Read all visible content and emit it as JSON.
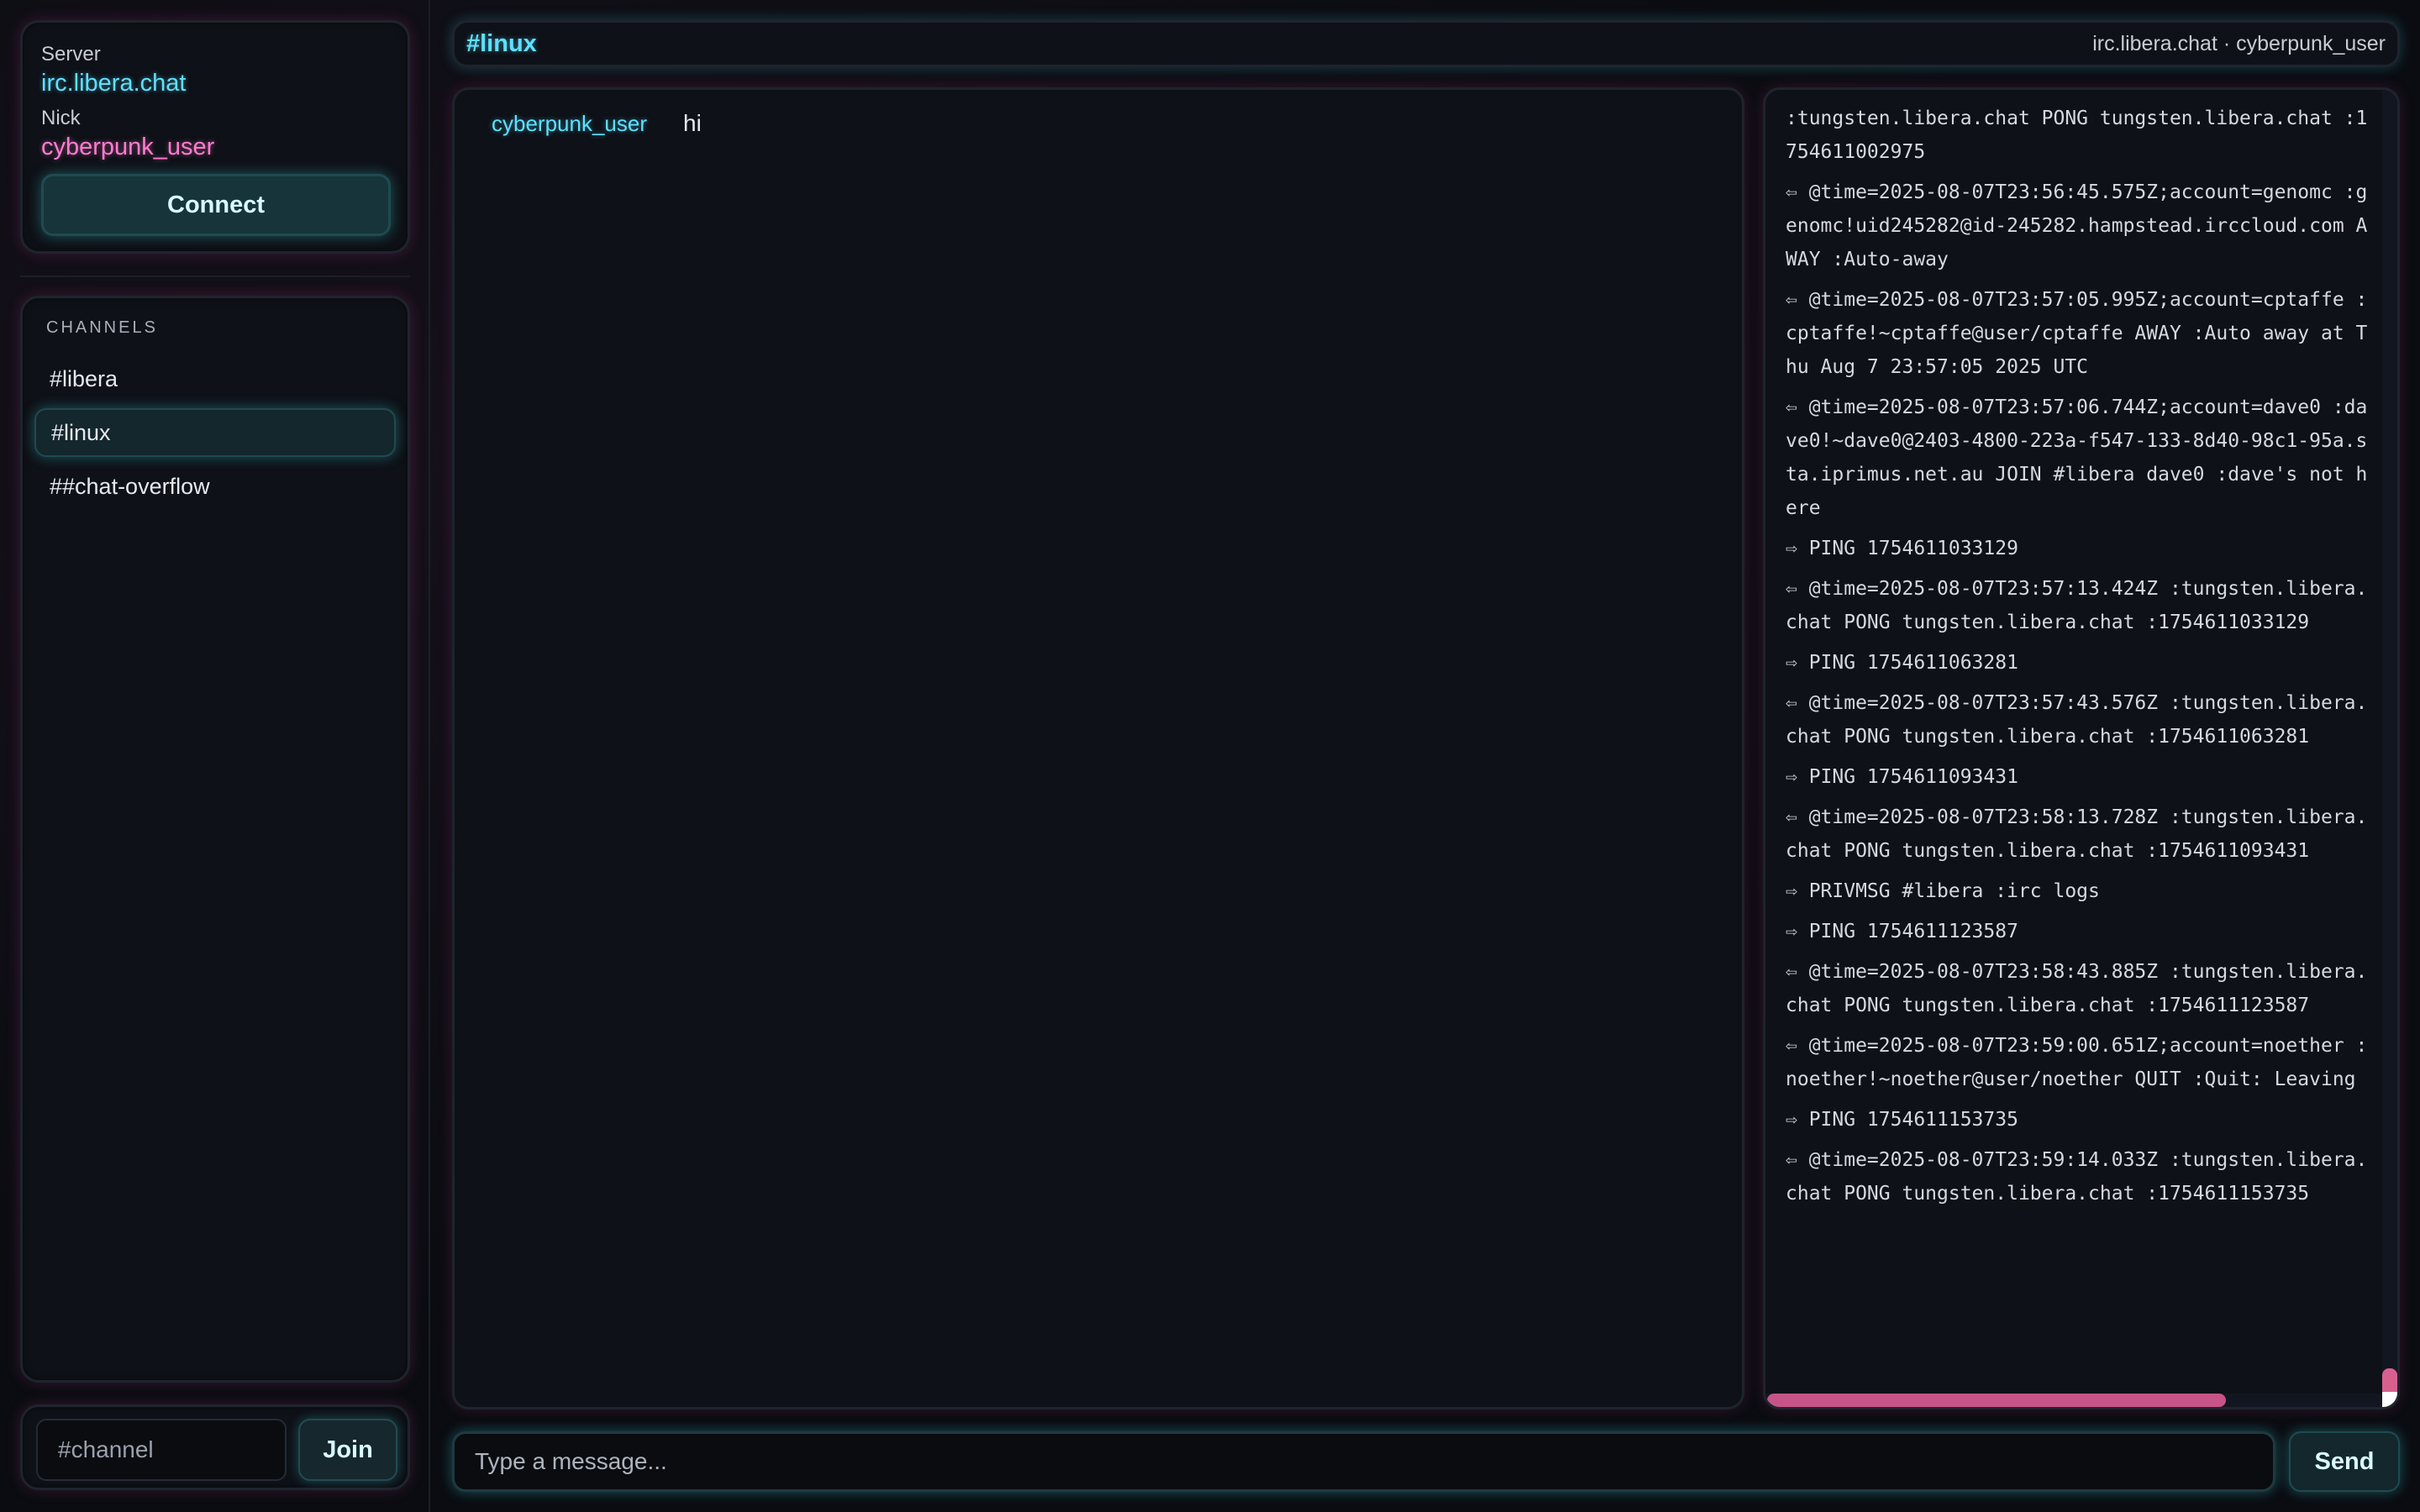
{
  "sidebar": {
    "server_label": "Server",
    "server_value": "irc.libera.chat",
    "nick_label": "Nick",
    "nick_value": "cyberpunk_user",
    "connect_label": "Connect",
    "channels_heading": "CHANNELS",
    "channels": [
      {
        "name": "#libera",
        "active": false
      },
      {
        "name": "#linux",
        "active": true
      },
      {
        "name": "##chat-overflow",
        "active": false
      }
    ],
    "join_placeholder": "#channel",
    "join_label": "Join"
  },
  "header": {
    "title": "#linux",
    "info": "irc.libera.chat · cyberpunk_user"
  },
  "chat": {
    "messages": [
      {
        "nick": "cyberpunk_user",
        "text": "hi"
      }
    ]
  },
  "log": {
    "entries": [
      ":tungsten.libera.chat PONG tungsten.libera.chat :1754611002975",
      "⇦ @time=2025-08-07T23:56:45.575Z;account=genomc :genomc!uid245282@id-245282.hampstead.irccloud.com AWAY :Auto-away",
      "⇦ @time=2025-08-07T23:57:05.995Z;account=cptaffe :cptaffe!~cptaffe@user/cptaffe AWAY :Auto away at Thu Aug 7 23:57:05 2025 UTC",
      "⇦ @time=2025-08-07T23:57:06.744Z;account=dave0 :dave0!~dave0@2403-4800-223a-f547-133-8d40-98c1-95a.sta.iprimus.net.au JOIN #libera dave0 :dave's not here",
      "⇨ PING 1754611033129",
      "⇦ @time=2025-08-07T23:57:13.424Z :tungsten.libera.chat PONG tungsten.libera.chat :1754611033129",
      "⇨ PING 1754611063281",
      "⇦ @time=2025-08-07T23:57:43.576Z :tungsten.libera.chat PONG tungsten.libera.chat :1754611063281",
      "⇨ PING 1754611093431",
      "⇦ @time=2025-08-07T23:58:13.728Z :tungsten.libera.chat PONG tungsten.libera.chat :1754611093431",
      "⇨ PRIVMSG #libera :irc logs",
      "⇨ PING 1754611123587",
      "⇦ @time=2025-08-07T23:58:43.885Z :tungsten.libera.chat PONG tungsten.libera.chat :1754611123587",
      "⇦ @time=2025-08-07T23:59:00.651Z;account=noether :noether!~noether@user/noether QUIT :Quit: Leaving",
      "⇨ PING 1754611153735",
      "⇦ @time=2025-08-07T23:59:14.033Z :tungsten.libera.chat PONG tungsten.libera.chat :1754611153735"
    ]
  },
  "composer": {
    "placeholder": "Type a message...",
    "send_label": "Send"
  },
  "colors": {
    "accent_cyan": "#5ee0ff",
    "accent_pink": "#ff7ccf",
    "background": "#0a0c11"
  }
}
